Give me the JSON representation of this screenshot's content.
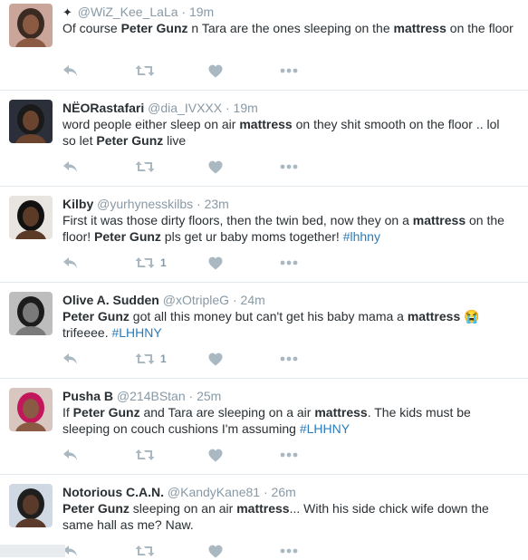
{
  "tweets": [
    {
      "name": "",
      "badge": "✦",
      "handle": "@WiZ_Kee_LaLa",
      "time": "19m",
      "segments": [
        {
          "t": "Of course "
        },
        {
          "t": "Peter Gunz",
          "s": "b"
        },
        {
          "t": " n Tara are the ones sleeping on the "
        },
        {
          "t": "mattress",
          "s": "b"
        },
        {
          "t": " on the floor"
        }
      ],
      "retweets": "",
      "avatar": {
        "bg": "#c9a59a",
        "skin": "#8a5a43",
        "hair": "#3a2a22"
      }
    },
    {
      "name": "NËORastafari",
      "handle": "@dia_IVXXX",
      "time": "19m",
      "segments": [
        {
          "t": "word people either sleep on air "
        },
        {
          "t": "mattress",
          "s": "b"
        },
        {
          "t": " on they shit smooth  on the floor .. lol so let "
        },
        {
          "t": "Peter Gunz",
          "s": "b"
        },
        {
          "t": " live"
        }
      ],
      "retweets": "",
      "avatar": {
        "bg": "#2a2f3a",
        "skin": "#6b4430",
        "hair": "#1a1a1a"
      }
    },
    {
      "name": "Kilby",
      "handle": "@yurhynesskilbs",
      "time": "23m",
      "segments": [
        {
          "t": "First it was those dirty floors, then the twin bed, now they on a "
        },
        {
          "t": "mattress",
          "s": "b"
        },
        {
          "t": " on the floor! "
        },
        {
          "t": "Peter Gunz",
          "s": "b"
        },
        {
          "t": " pls get ur baby moms together! "
        },
        {
          "t": "#lhhny",
          "s": "tag"
        }
      ],
      "retweets": "1",
      "avatar": {
        "bg": "#e8e4e0",
        "skin": "#5c3a28",
        "hair": "#111111"
      }
    },
    {
      "name": "Olive A. Sudden",
      "handle": "@xOtripleG",
      "time": "24m",
      "segments": [
        {
          "t": "Peter Gunz",
          "s": "b"
        },
        {
          "t": " got all this money but can't get his baby mama a "
        },
        {
          "t": "mattress",
          "s": "b"
        },
        {
          "t": " 😭 trifeeee. "
        },
        {
          "t": "#LHHNY",
          "s": "tag"
        }
      ],
      "retweets": "1",
      "avatar": {
        "bg": "#bdbdbd",
        "skin": "#7a7a7a",
        "hair": "#1c1c1c"
      }
    },
    {
      "name": "Pusha B",
      "handle": "@214BStan",
      "time": "25m",
      "segments": [
        {
          "t": "If "
        },
        {
          "t": "Peter Gunz",
          "s": "b"
        },
        {
          "t": " and Tara are sleeping on a air "
        },
        {
          "t": "mattress",
          "s": "b"
        },
        {
          "t": ". The kids must be sleeping on couch cushions I'm assuming "
        },
        {
          "t": "#LHHNY",
          "s": "tag"
        }
      ],
      "retweets": "",
      "avatar": {
        "bg": "#d8c7c0",
        "skin": "#8b5a44",
        "hair": "#c2185b"
      }
    },
    {
      "name": "Notorious C.A.N.",
      "handle": "@KandyKane81",
      "time": "26m",
      "segments": [
        {
          "t": "Peter Gunz",
          "s": "b"
        },
        {
          "t": " sleeping on an air "
        },
        {
          "t": "mattress",
          "s": "b"
        },
        {
          "t": "... With his side chick wife down the same hall as me? Naw."
        }
      ],
      "retweets": "",
      "avatar": {
        "bg": "#cfd8e3",
        "skin": "#5a3a2a",
        "hair": "#1e1e1e"
      }
    }
  ],
  "icons": {
    "reply": "reply-icon",
    "retweet": "retweet-icon",
    "like": "heart-icon",
    "more": "more-dots-icon"
  },
  "colors": {
    "text": "#292f33",
    "muted": "#8899a6",
    "icon": "#aab8c2",
    "hashtag": "#2b7bb9",
    "divider": "#e1e8ed"
  }
}
